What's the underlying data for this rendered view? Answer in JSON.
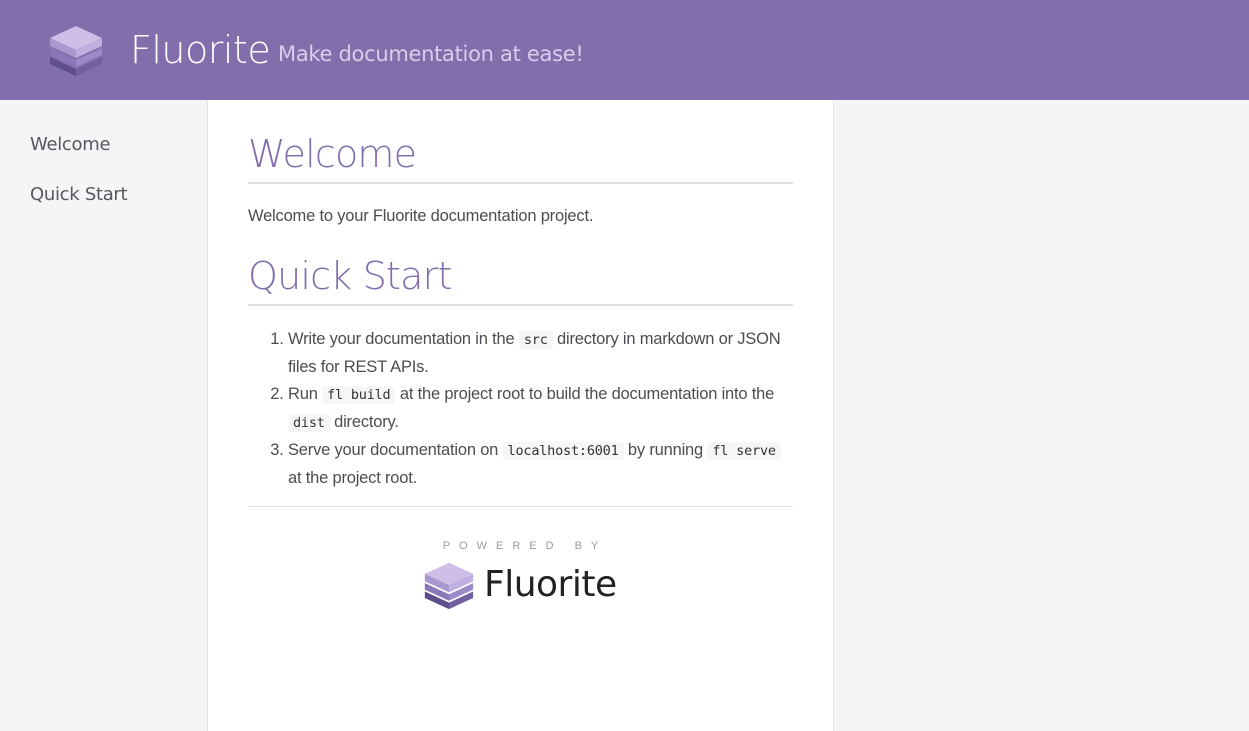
{
  "header": {
    "brand": "Fluorite",
    "tagline": "Make documentation at ease!",
    "logo_icon": "layered-cube-icon"
  },
  "sidebar": {
    "items": [
      {
        "label": "Welcome"
      },
      {
        "label": "Quick Start"
      }
    ]
  },
  "content": {
    "welcome_heading": "Welcome",
    "welcome_text": "Welcome to your Fluorite documentation project.",
    "quickstart_heading": "Quick Start",
    "steps": [
      {
        "pre": "Write your documentation in the ",
        "code": "src",
        "post": " directory in markdown or JSON files for REST APIs."
      },
      {
        "pre": "Run ",
        "code": "fl build",
        "post": " at the project root to build the documentation into the ",
        "code2": "dist",
        "post2": " directory."
      },
      {
        "pre": "Serve your documentation on ",
        "code": "localhost:6001",
        "post": " by running ",
        "code2": "fl serve",
        "post2": " at the project root."
      }
    ]
  },
  "footer": {
    "powered_by": "POWERED BY",
    "brand": "Fluorite"
  },
  "colors": {
    "accent": "#836eac",
    "header_bg": "#836eac",
    "page_bg": "#f4f5f7"
  }
}
